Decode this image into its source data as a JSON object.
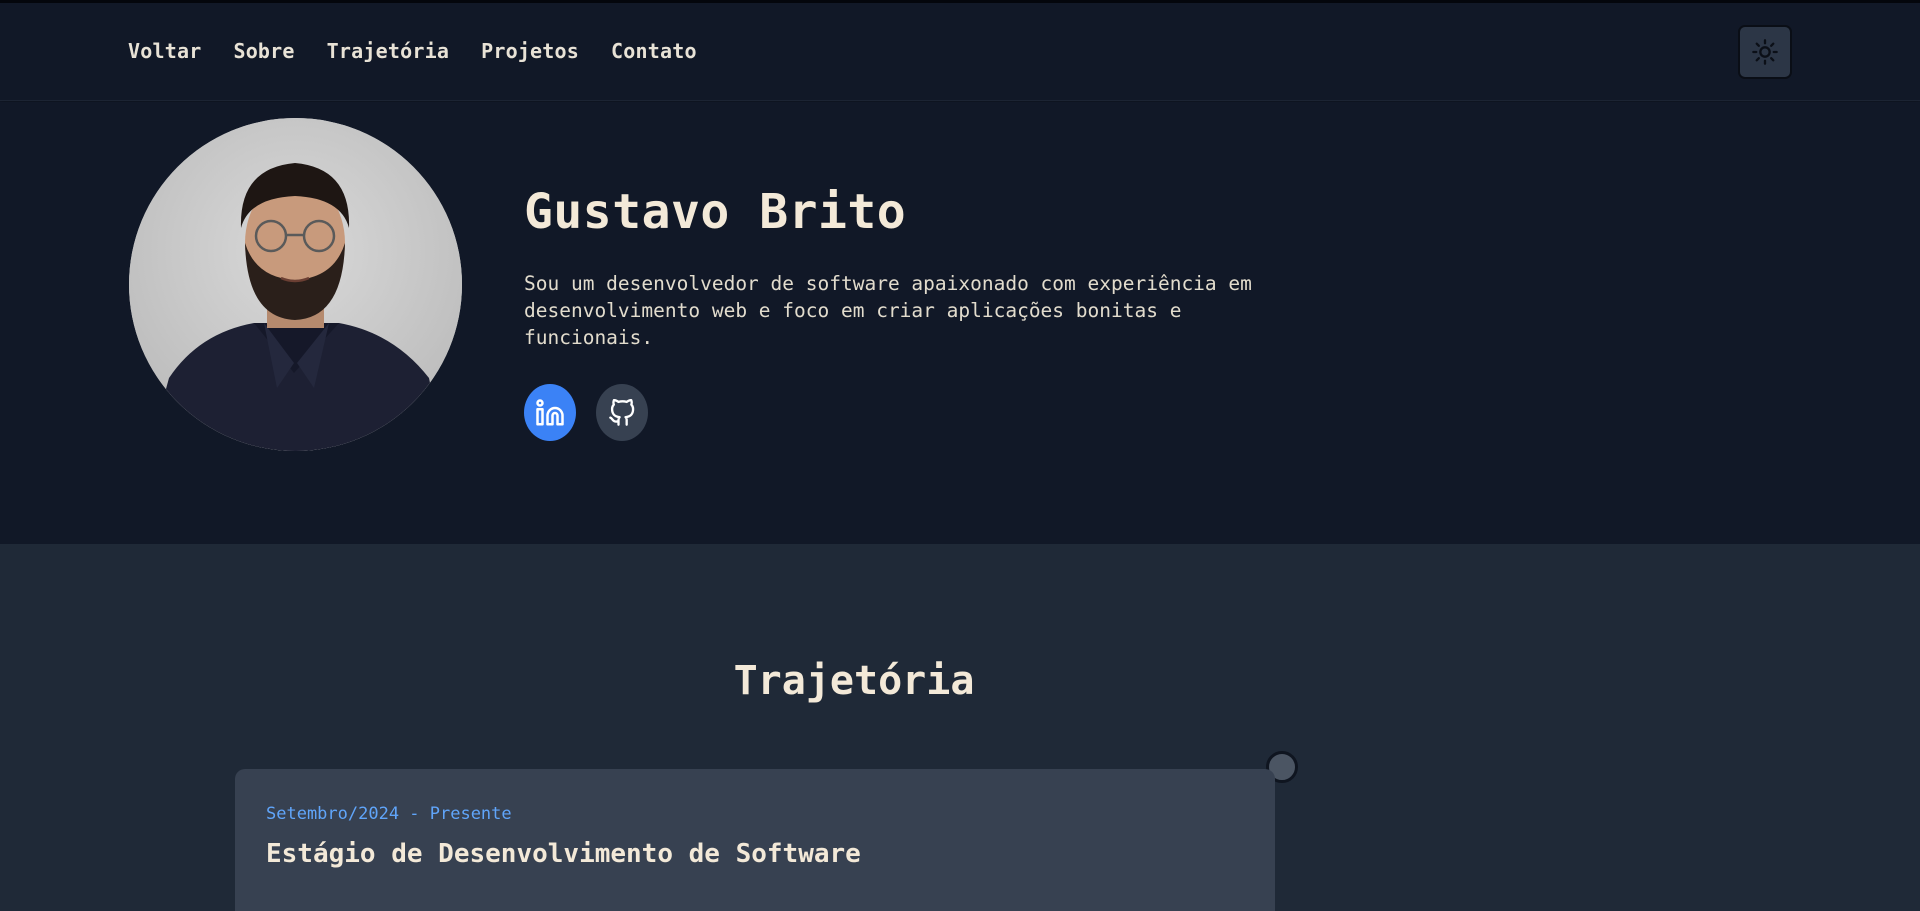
{
  "nav": {
    "items": [
      {
        "label": "Voltar"
      },
      {
        "label": "Sobre"
      },
      {
        "label": "Trajetória"
      },
      {
        "label": "Projetos"
      },
      {
        "label": "Contato"
      }
    ],
    "theme_toggle_icon": "sun-icon"
  },
  "hero": {
    "name": "Gustavo Brito",
    "bio": "Sou um desenvolvedor de software apaixonado com experiência em desenvolvimento web e foco em criar aplicações bonitas e funcionais.",
    "socials": [
      {
        "icon": "linkedin-icon"
      },
      {
        "icon": "github-icon"
      }
    ]
  },
  "trajectory": {
    "title": "Trajetória",
    "items": [
      {
        "date": "Setembro/2024 - Presente",
        "role": "Estágio de Desenvolvimento de Software"
      }
    ]
  },
  "colors": {
    "background": "#111827",
    "section_background": "#1f2937",
    "card_background": "#374151",
    "accent": "#3b82f6",
    "date_text": "#60a5fa",
    "text_primary": "#f3e9d8"
  }
}
